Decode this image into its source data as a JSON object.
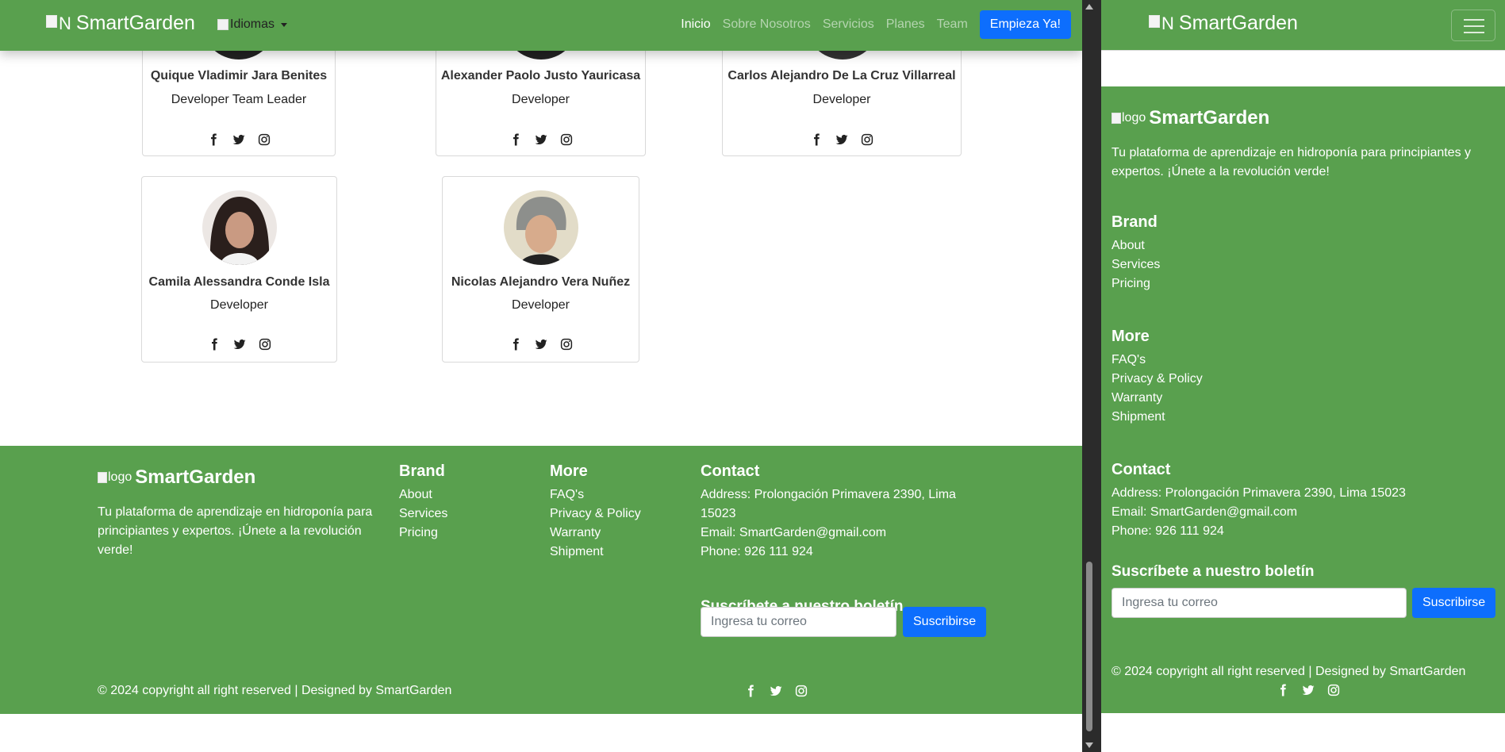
{
  "nav": {
    "brand_alt": "N",
    "brand": "SmartGarden",
    "lang_label": "Idiomas",
    "links": [
      {
        "label": "Inicio"
      },
      {
        "label": "Sobre Nosotros"
      },
      {
        "label": "Servicios"
      },
      {
        "label": "Planes"
      },
      {
        "label": "Team"
      }
    ],
    "cta": "Empieza Ya!"
  },
  "team": [
    {
      "name": "Quique Vladimir Jara Benites",
      "role": "Developer Team Leader"
    },
    {
      "name": "Alexander Paolo Justo Yauricasa",
      "role": "Developer"
    },
    {
      "name": "Carlos Alejandro De La Cruz Villarreal",
      "role": "Developer"
    },
    {
      "name": "Camila Alessandra Conde Isla",
      "role": "Developer"
    },
    {
      "name": "Nicolas Alejandro Vera Nuñez",
      "role": "Developer"
    }
  ],
  "footer": {
    "logo_alt": "logo",
    "brand": "SmartGarden",
    "tagline": "Tu plataforma de aprendizaje en hidroponía para principiantes y expertos. ¡Únete a la revolución verde!",
    "brand_heading": "Brand",
    "brand_links": [
      "About",
      "Services",
      "Pricing"
    ],
    "more_heading": "More",
    "more_links": [
      "FAQ's",
      "Privacy & Policy",
      "Warranty",
      "Shipment"
    ],
    "contact_heading": "Contact",
    "address": "Address: Prolongación Primavera 2390, Lima 15023",
    "email": "Email: SmartGarden@gmail.com",
    "phone": "Phone: 926 111 924",
    "newsletter_heading": "Suscríbete a nuestro boletín",
    "newsletter_placeholder": "Ingresa tu correo",
    "subscribe": "Suscribirse",
    "copyright": "© 2024 copyright all right reserved | Designed by SmartGarden"
  },
  "colors": {
    "green": "#59a04e",
    "blue": "#0d6efd"
  }
}
